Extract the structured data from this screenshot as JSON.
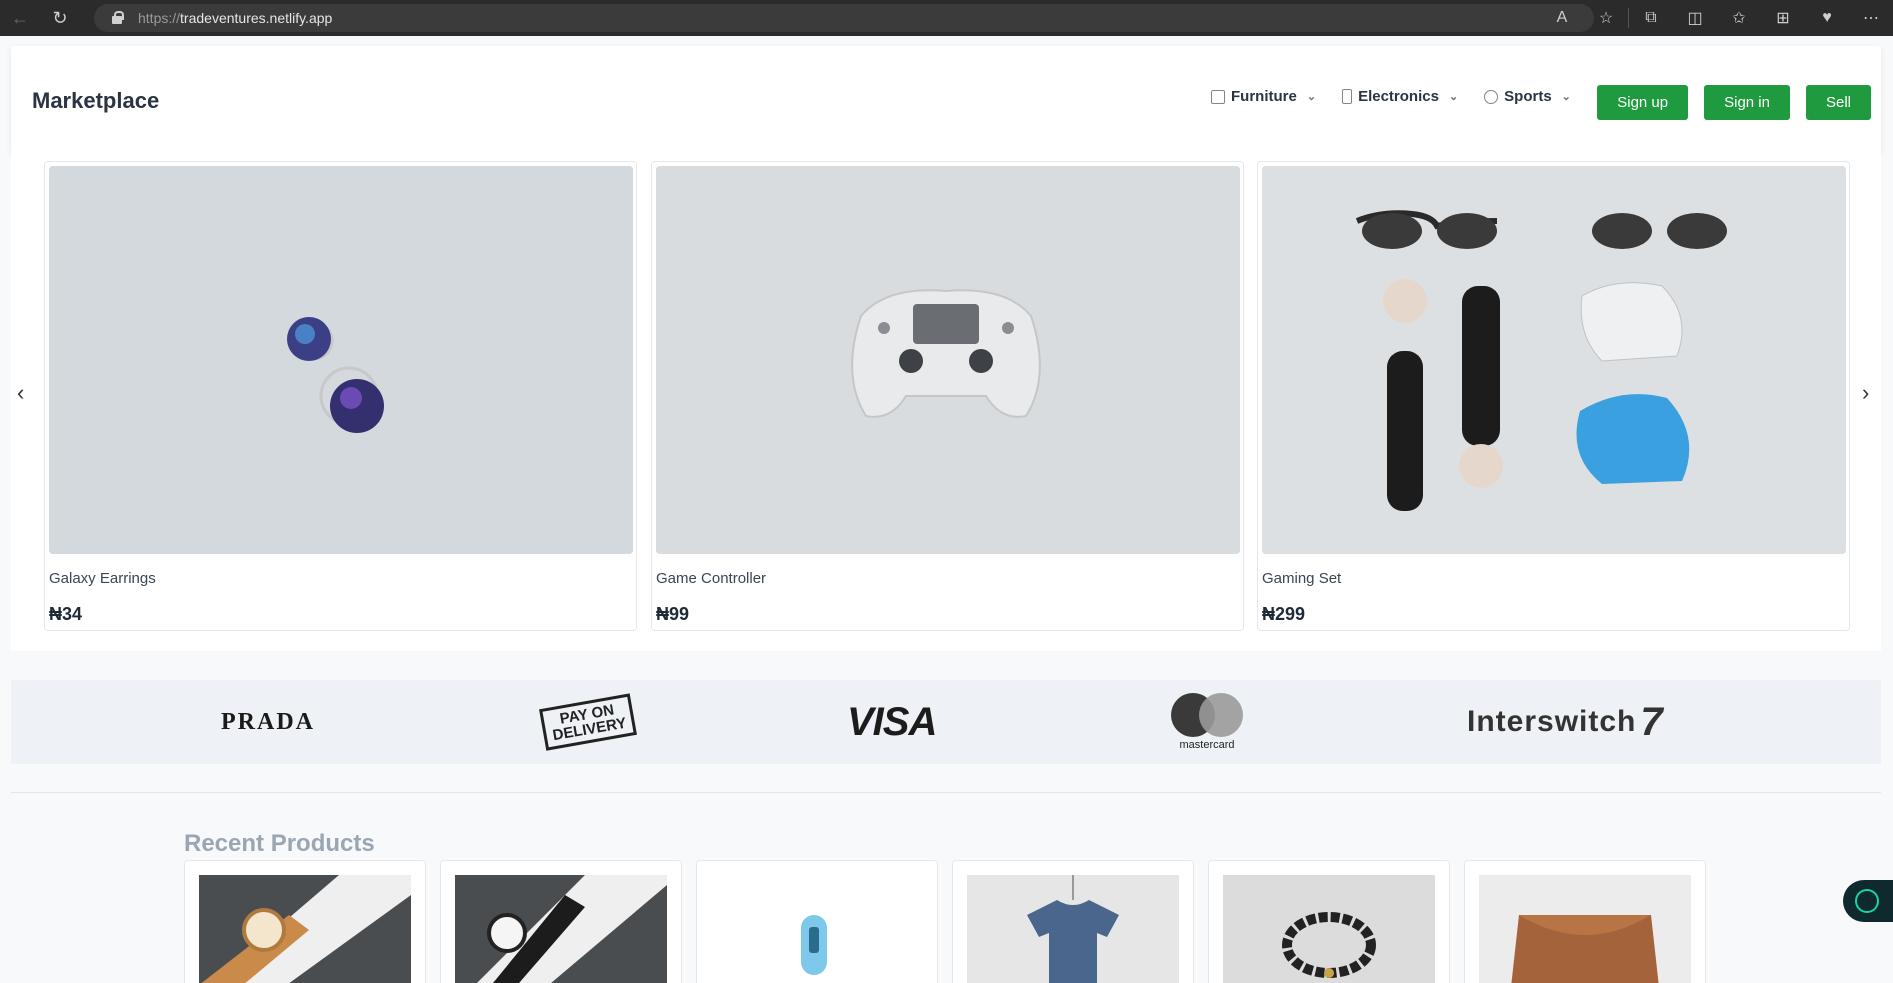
{
  "browser": {
    "url_scheme": "https://",
    "url_host": "tradeventures.netlify.app"
  },
  "header": {
    "brand": "Marketplace",
    "categories": [
      {
        "label": "Furniture",
        "icon": "box-icon"
      },
      {
        "label": "Electronics",
        "icon": "phone-icon"
      },
      {
        "label": "Sports",
        "icon": "clock-icon"
      }
    ],
    "buttons": {
      "signup": "Sign up",
      "signin": "Sign in",
      "sell": "Sell"
    },
    "accent_color": "#1f9a3e"
  },
  "carousel": {
    "items": [
      {
        "name": "Galaxy Earrings",
        "price": "₦34"
      },
      {
        "name": "Game Controller",
        "price": "₦99"
      },
      {
        "name": "Gaming Set",
        "price": "₦299"
      }
    ]
  },
  "brands": {
    "prada": "PRADA",
    "pod_line1": "PAY ON",
    "pod_line2": "DELIVERY",
    "visa": "VISA",
    "mastercard": "mastercard",
    "interswitch": "Interswitch"
  },
  "recent": {
    "title": "Recent Products"
  }
}
